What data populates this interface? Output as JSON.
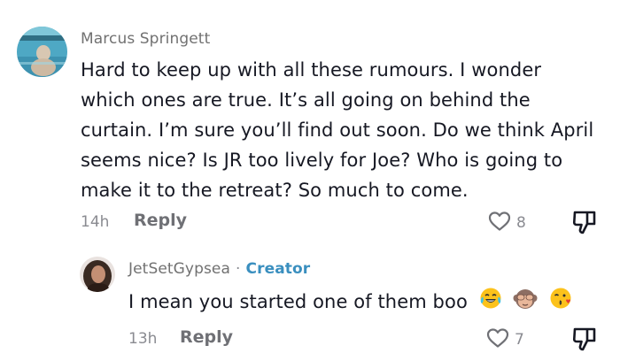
{
  "comments": [
    {
      "author": "Marcus Springett",
      "text": "Hard to keep up with all these rumours. I wonder which ones are true. It’s all going on behind the curtain. I’m sure you’ll find out soon. Do we think April seems nice? Is JR too lively for Joe? Who is going to make it to the retreat? So much to come.",
      "time": "14h",
      "reply_label": "Reply",
      "likes": "8"
    }
  ],
  "replies": [
    {
      "author": "JetSetGypsea",
      "separator": "·",
      "badge": "Creator",
      "text": "I mean you started one of them boo",
      "emojis": [
        "face-with-tears-of-joy",
        "see-no-evil-monkey",
        "face-blowing-a-kiss"
      ],
      "time": "13h",
      "reply_label": "Reply",
      "likes": "7"
    }
  ],
  "colors": {
    "text": "#161823",
    "secondary": "#8a8b91",
    "creator": "#3a8fbf"
  }
}
